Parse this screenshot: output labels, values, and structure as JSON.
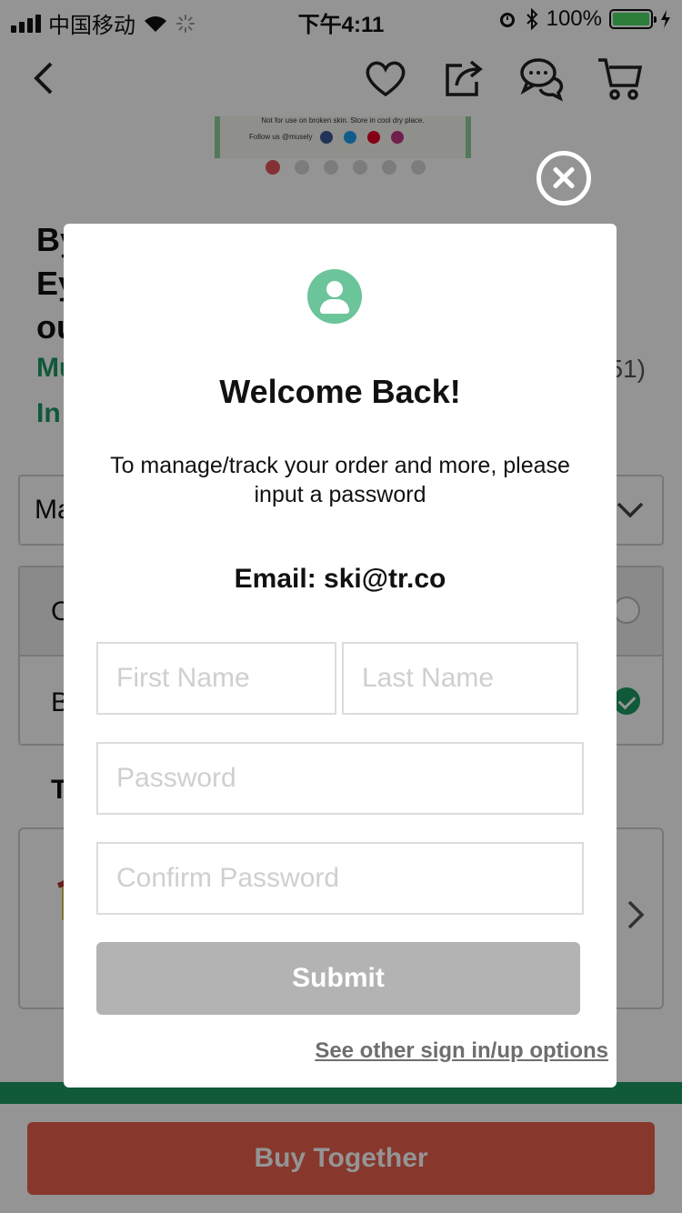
{
  "status_bar": {
    "carrier": "中国移动",
    "time": "下午4:11",
    "battery_percent": "100%",
    "icons": [
      "signal-icon",
      "wifi-icon",
      "loading-icon",
      "alarm-icon",
      "bluetooth-icon",
      "battery-icon",
      "charging-icon"
    ]
  },
  "nav": {
    "icons": [
      "back-icon",
      "heart-icon",
      "share-icon",
      "chat-icon",
      "cart-icon"
    ]
  },
  "product": {
    "image_text_1": "Not for use on broken skin. Store in cool dry place.",
    "image_text_2": "Follow us @musely",
    "image_count": 6,
    "active_image_index": 0,
    "title_partial": "By\nEy\nou",
    "brand_partial": "Mu",
    "rating_partial": "51)",
    "stock_partial": "In",
    "select_partial": "Ma",
    "option_1_partial": "O",
    "option_2_partial": "B",
    "section_partial": "T",
    "buy_together_label": "Buy Together"
  },
  "modal": {
    "title": "Welcome Back!",
    "subtitle": "To manage/track your order and more, please input a password",
    "email_line": "Email: ski@tr.co",
    "first_name_placeholder": "First Name",
    "last_name_placeholder": "Last Name",
    "password_placeholder": "Password",
    "confirm_password_placeholder": "Confirm Password",
    "submit_label": "Submit",
    "other_options_link": "See other sign in/up options"
  },
  "colors": {
    "brand_green": "#1c9a63",
    "avatar_green": "#6cc49a",
    "buy_button": "#e8604c",
    "submit_disabled": "#b3b3b3"
  }
}
